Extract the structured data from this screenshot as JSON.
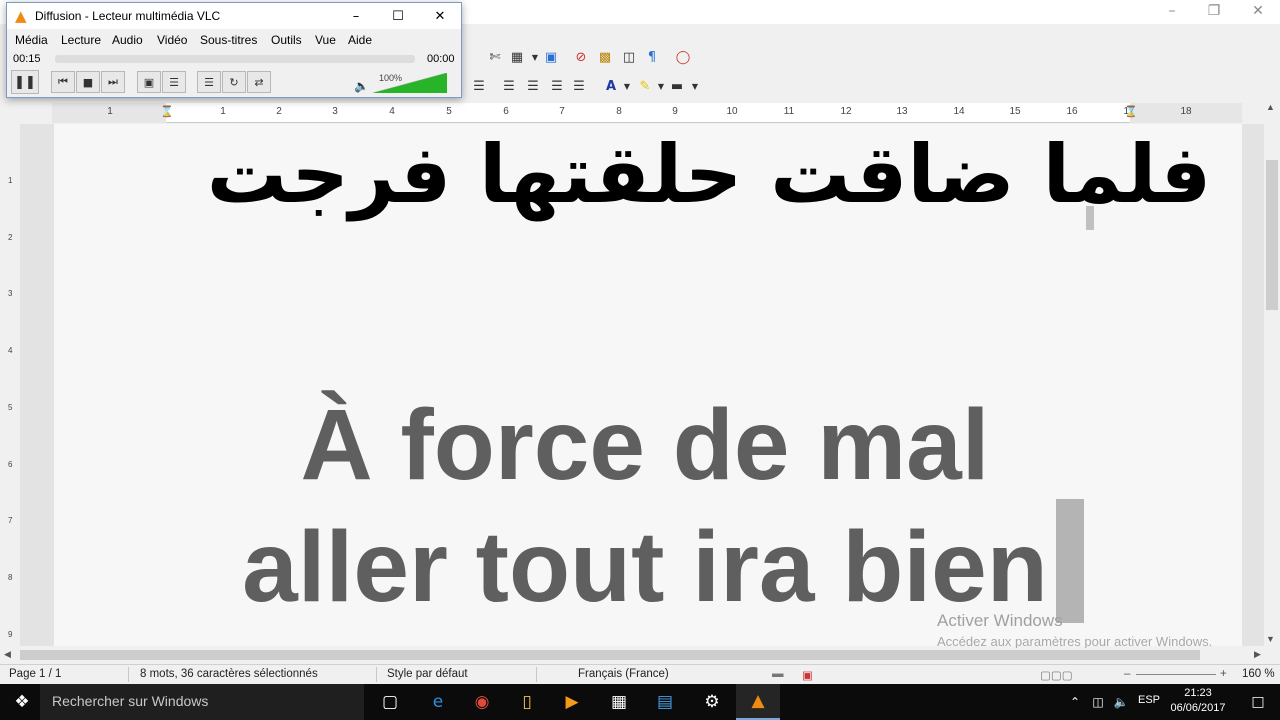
{
  "vlc": {
    "title": "Diffusion - Lecteur multimédia VLC",
    "menu": [
      "Média",
      "Lecture",
      "Audio",
      "Vidéo",
      "Sous-titres",
      "Outils",
      "Vue",
      "Aide"
    ],
    "elapsed": "00:15",
    "total": "00:00",
    "volume_label": "100%",
    "volume_level": 1.0,
    "seek_progress": 0.0,
    "accent": "#28b428"
  },
  "writer": {
    "ruler_numbers": [
      "1",
      "1",
      "2",
      "3",
      "4",
      "5",
      "6",
      "7",
      "8",
      "9",
      "10",
      "11",
      "12",
      "13",
      "14",
      "15",
      "16",
      "17",
      "18"
    ],
    "vruler_numbers": [
      "1",
      "2",
      "3",
      "4",
      "5",
      "6",
      "7",
      "8",
      "9"
    ]
  },
  "document": {
    "arabic_line": "فلما ضاقت حلقتها فرجت",
    "french_line1": "À force de mal",
    "french_line2": "aller tout ira bien"
  },
  "status": {
    "page": "Page 1 / 1",
    "words": "8 mots, 36 caractères sélectionnés",
    "style": "Style par défaut",
    "language": "Français (France)",
    "zoom": "160 %"
  },
  "watermark": {
    "title": "Activer Windows",
    "subtitle": "Accédez aux paramètres pour activer Windows."
  },
  "taskbar": {
    "search_placeholder": "Rechercher sur Windows",
    "lang": "ESP",
    "time": "21:23",
    "date": "06/06/2017"
  }
}
